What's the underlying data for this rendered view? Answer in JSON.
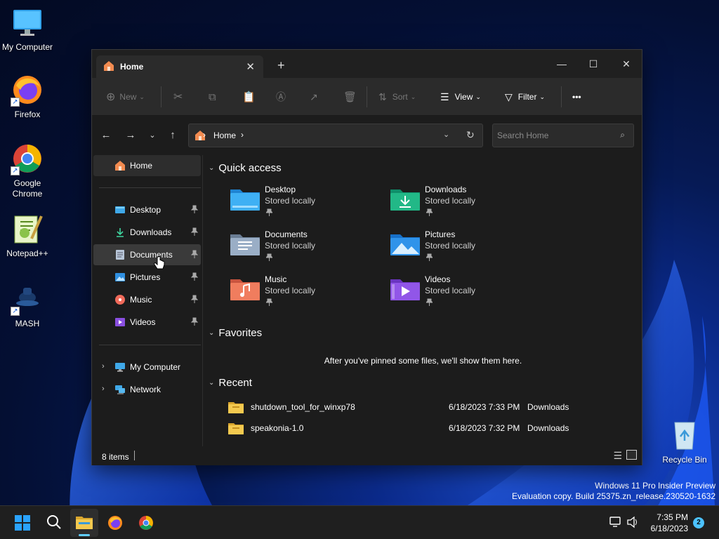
{
  "desktop": {
    "icons": [
      {
        "label": "My Computer",
        "icon": "monitor-icon"
      },
      {
        "label": "Firefox",
        "icon": "firefox-icon"
      },
      {
        "label": "Google Chrome",
        "icon": "chrome-icon"
      },
      {
        "label": "Notepad++",
        "icon": "notepadpp-icon"
      },
      {
        "label": "MASH",
        "icon": "mash-icon"
      },
      {
        "label": "Recycle Bin",
        "icon": "recycle-bin-icon"
      }
    ],
    "watermark": {
      "line1": "Windows 11 Pro Insider Preview",
      "line2": "Evaluation copy. Build 25375.zn_release.230520-1632"
    }
  },
  "explorer": {
    "tab_title": "Home",
    "toolbar": {
      "new_label": "New",
      "sort_label": "Sort",
      "view_label": "View",
      "filter_label": "Filter",
      "more_label": "•••"
    },
    "address": {
      "crumb": "Home",
      "search_placeholder": "Search Home"
    },
    "sidebar": {
      "home": "Home",
      "pinned": [
        {
          "label": "Desktop",
          "icon": "desktop-folder-icon"
        },
        {
          "label": "Downloads",
          "icon": "download-icon"
        },
        {
          "label": "Documents",
          "icon": "documents-icon"
        },
        {
          "label": "Pictures",
          "icon": "pictures-icon"
        },
        {
          "label": "Music",
          "icon": "music-icon"
        },
        {
          "label": "Videos",
          "icon": "videos-icon"
        }
      ],
      "tree": [
        {
          "label": "My Computer",
          "icon": "monitor-icon"
        },
        {
          "label": "Network",
          "icon": "network-icon"
        }
      ]
    },
    "quick_access": {
      "heading": "Quick access",
      "items": [
        {
          "name": "Desktop",
          "sub": "Stored locally"
        },
        {
          "name": "Downloads",
          "sub": "Stored locally"
        },
        {
          "name": "Documents",
          "sub": "Stored locally"
        },
        {
          "name": "Pictures",
          "sub": "Stored locally"
        },
        {
          "name": "Music",
          "sub": "Stored locally"
        },
        {
          "name": "Videos",
          "sub": "Stored locally"
        }
      ]
    },
    "favorites": {
      "heading": "Favorites",
      "empty_message": "After you've pinned some files, we'll show them here."
    },
    "recent": {
      "heading": "Recent",
      "rows": [
        {
          "name": "shutdown_tool_for_winxp78",
          "date": "6/18/2023 7:33 PM",
          "location": "Downloads"
        },
        {
          "name": "speakonia-1.0",
          "date": "6/18/2023 7:32 PM",
          "location": "Downloads"
        }
      ]
    },
    "status": {
      "item_count": "8 items"
    }
  },
  "taskbar": {
    "time": "7:35 PM",
    "date": "6/18/2023",
    "notification_count": "2"
  },
  "colors": {
    "accent": "#60cdff",
    "window_bg": "#1c1c1c",
    "toolbar_bg": "#2b2b2b"
  }
}
